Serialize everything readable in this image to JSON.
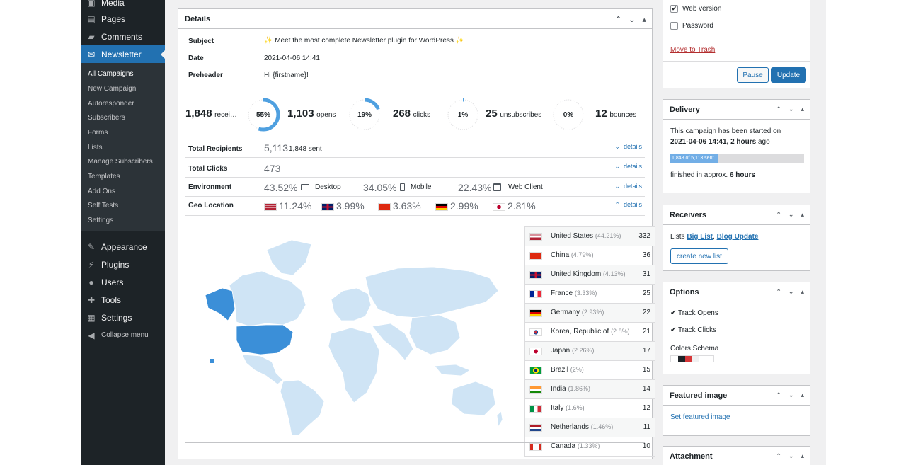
{
  "sidebar": {
    "top": [
      {
        "label": "Media",
        "icon": "media-icon"
      },
      {
        "label": "Pages",
        "icon": "pages-icon"
      },
      {
        "label": "Comments",
        "icon": "comments-icon"
      },
      {
        "label": "Newsletter",
        "icon": "envelope-icon"
      }
    ],
    "sub": [
      "All Campaigns",
      "New Campaign",
      "Autoresponder",
      "Subscribers",
      "Forms",
      "Lists",
      "Manage Subscribers",
      "Templates",
      "Add Ons",
      "Self Tests",
      "Settings"
    ],
    "bottom": [
      {
        "label": "Appearance",
        "icon": "brush-icon"
      },
      {
        "label": "Plugins",
        "icon": "plug-icon"
      },
      {
        "label": "Users",
        "icon": "user-icon"
      },
      {
        "label": "Tools",
        "icon": "wrench-icon"
      },
      {
        "label": "Settings",
        "icon": "sliders-icon"
      },
      {
        "label": "Collapse menu",
        "icon": "collapse-icon"
      }
    ]
  },
  "details": {
    "title": "Details",
    "subject_label": "Subject",
    "subject": "✨ Meet the most complete Newsletter plugin for WordPress ✨",
    "date_label": "Date",
    "date": "2021-04-06 14:41",
    "preheader_label": "Preheader",
    "preheader": "Hi {firstname}!",
    "stats": {
      "recipients": "1,848",
      "recipients_unit": "recei…",
      "open_rate": "55%",
      "open_rate_value": 0.55,
      "opens": "1,103",
      "opens_unit": "opens",
      "click_rate": "19%",
      "click_rate_value": 0.19,
      "clicks": "268",
      "clicks_unit": "clicks",
      "unsub_rate": "1%",
      "unsub_rate_value": 0.01,
      "unsubscribes": "25",
      "unsubscribes_unit": "unsubscribes",
      "bounce_rate": "0%",
      "bounce_rate_value": 0,
      "bounces": "12",
      "bounces_unit": "bounces"
    },
    "total_recipients_label": "Total Recipients",
    "total_recipients": "5,113",
    "sent": "1,848 sent",
    "total_clicks_label": "Total Clicks",
    "total_clicks": "473",
    "environment_label": "Environment",
    "env": [
      {
        "pct": "43.52%",
        "name": "Desktop",
        "icon": "desktop-icon"
      },
      {
        "pct": "34.05%",
        "name": "Mobile",
        "icon": "mobile-icon"
      },
      {
        "pct": "22.43%",
        "name": "Web Client",
        "icon": "browser-icon"
      }
    ],
    "geo_label": "Geo Location",
    "geo_top": [
      {
        "pct": "11.24%",
        "flag": "us-flag"
      },
      {
        "pct": "3.99%",
        "flag": "uk-flag"
      },
      {
        "pct": "3.63%",
        "flag": "cn-flag"
      },
      {
        "pct": "2.99%",
        "flag": "de-flag"
      },
      {
        "pct": "2.81%",
        "flag": "jp-flag"
      }
    ],
    "details_link": "details",
    "countries": [
      {
        "name": "United States",
        "pct": "(44.21%)",
        "count": "332",
        "flag": "us-flag"
      },
      {
        "name": "China",
        "pct": "(4.79%)",
        "count": "36",
        "flag": "cn-flag"
      },
      {
        "name": "United Kingdom",
        "pct": "(4.13%)",
        "count": "31",
        "flag": "uk-flag"
      },
      {
        "name": "France",
        "pct": "(3.33%)",
        "count": "25",
        "flag": "fr-flag"
      },
      {
        "name": "Germany",
        "pct": "(2.93%)",
        "count": "22",
        "flag": "de-flag"
      },
      {
        "name": "Korea, Republic of",
        "pct": "(2.8%)",
        "count": "21",
        "flag": "kr-flag"
      },
      {
        "name": "Japan",
        "pct": "(2.26%)",
        "count": "17",
        "flag": "jp-flag"
      },
      {
        "name": "Brazil",
        "pct": "(2%)",
        "count": "15",
        "flag": "br-flag"
      },
      {
        "name": "India",
        "pct": "(1.86%)",
        "count": "14",
        "flag": "in-flag"
      },
      {
        "name": "Italy",
        "pct": "(1.6%)",
        "count": "12",
        "flag": "it-flag"
      },
      {
        "name": "Netherlands",
        "pct": "(1.46%)",
        "count": "11",
        "flag": "nl-flag"
      },
      {
        "name": "Canada",
        "pct": "(1.33%)",
        "count": "10",
        "flag": "ca-flag"
      }
    ]
  },
  "publish": {
    "web_version": "Web version",
    "password": "Password",
    "trash": "Move to Trash",
    "pause": "Pause",
    "update": "Update"
  },
  "delivery": {
    "title": "Delivery",
    "line1": "This campaign has been started on",
    "started": "2021-04-06 14:41, 2 hours",
    "ago": "ago",
    "progress_label": "1,848 of 5,113 sent",
    "progress_value": 0.361,
    "finished_prefix": "finished in approx.",
    "finished_time": "6 hours"
  },
  "receivers": {
    "title": "Receivers",
    "lists_label": "Lists",
    "list1": "Big List",
    "sep": ",",
    "list2": "Blog Update",
    "create": "create new list"
  },
  "options": {
    "title": "Options",
    "track_opens": "Track Opens",
    "track_clicks": "Track Clicks",
    "colors_label": "Colors Schema",
    "swatches": [
      "#ffffff",
      "#1d2327",
      "#d63638",
      "#f0f0f1",
      "#ffffff",
      "#ffffff"
    ]
  },
  "featured": {
    "title": "Featured image",
    "set": "Set featured image"
  },
  "attachment": {
    "title": "Attachment"
  },
  "colors": {
    "accent": "#2271b1",
    "map_land": "#cfe4f5",
    "map_us": "#3b8fd8",
    "map_high": "#8cc0ea"
  }
}
